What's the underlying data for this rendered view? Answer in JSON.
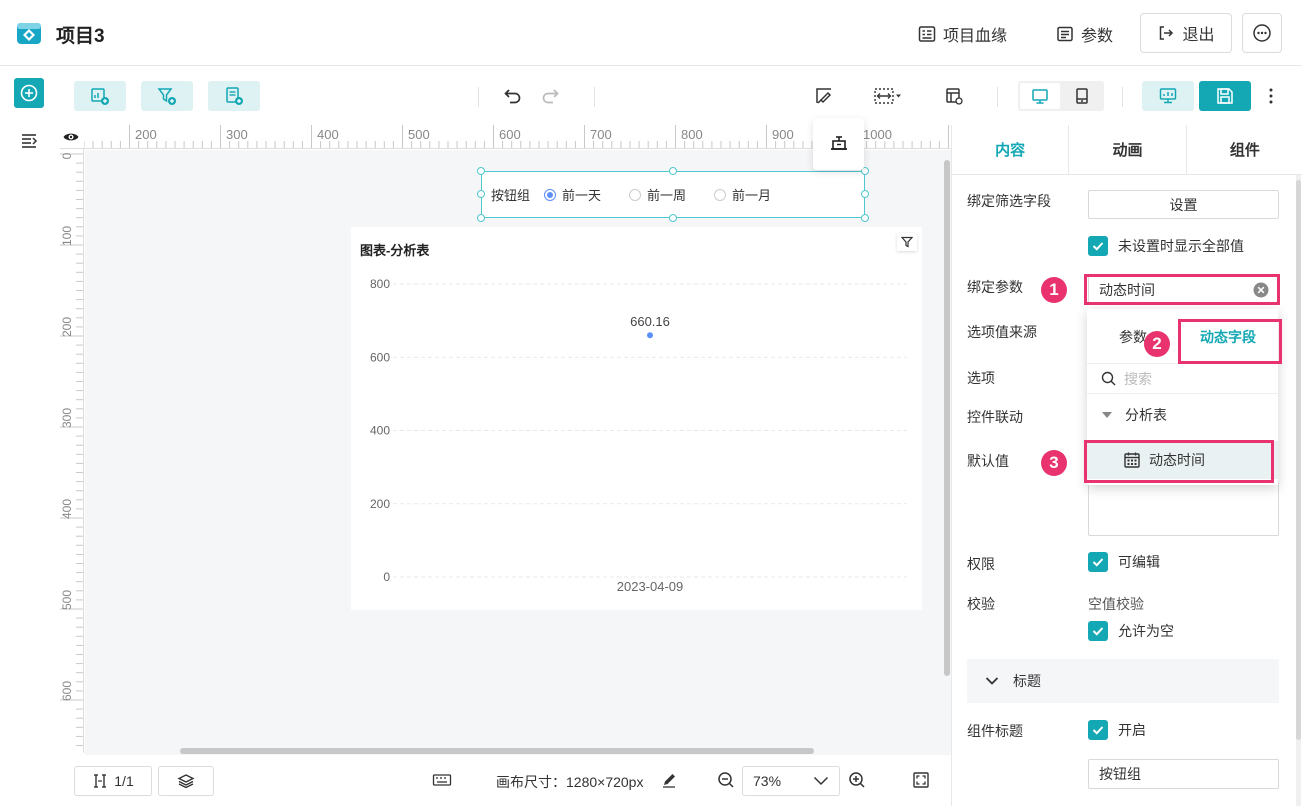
{
  "header": {
    "title": "项目3",
    "lineage": "项目血缘",
    "params": "参数",
    "exit": "退出"
  },
  "ruler": {
    "top": [
      "200",
      "300",
      "400",
      "500",
      "600",
      "700",
      "800",
      "900",
      "1000"
    ],
    "left": [
      "0",
      "100",
      "200",
      "300",
      "400",
      "500",
      "600"
    ]
  },
  "canvas": {
    "button_group": {
      "label": "按钮组",
      "options": [
        "前一天",
        "前一周",
        "前一月"
      ],
      "selected_index": 0
    },
    "chart_title": "图表-分析表"
  },
  "chart_data": {
    "type": "scatter",
    "title": "图表-分析表",
    "x": [
      "2023-04-09"
    ],
    "values": [
      660.16
    ],
    "data_labels": [
      "660.16"
    ],
    "yticks": [
      "800",
      "600",
      "400",
      "200",
      "0"
    ],
    "ylim": [
      0,
      800
    ],
    "grid": true,
    "point_color": "#5b8ff9"
  },
  "bottom": {
    "page_indicator": "1/1",
    "canvas_size_label": "画布尺寸：1280×720px",
    "zoom": "73%"
  },
  "panel": {
    "tabs": [
      "内容",
      "动画",
      "组件"
    ],
    "active_tab": 0,
    "bind_filter_label": "绑定筛选字段",
    "settings_button": "设置",
    "show_all_checkbox": "未设置时显示全部值",
    "bind_param_label": "绑定参数",
    "bind_param_value": "动态时间",
    "option_source_label": "选项值来源",
    "options_label": "选项",
    "linkage_label": "控件联动",
    "default_label": "默认值",
    "permission_label": "权限",
    "editable_checkbox": "可编辑",
    "validation_label": "校验",
    "null_check_label": "空值校验",
    "allow_null_checkbox": "允许为空",
    "section_title": "标题",
    "component_title_label": "组件标题",
    "enable_checkbox": "开启",
    "title_input_value": "按钮组"
  },
  "dropdown": {
    "tab_params": "参数",
    "tab_dynamic": "动态字段",
    "search_placeholder": "搜索",
    "group": "分析表",
    "item": "动态时间"
  },
  "annotations": [
    "1",
    "2",
    "3"
  ],
  "colors": {
    "accent": "#14a8b4",
    "highlight": "#e8336e",
    "chip_bg": "#def2f3"
  }
}
